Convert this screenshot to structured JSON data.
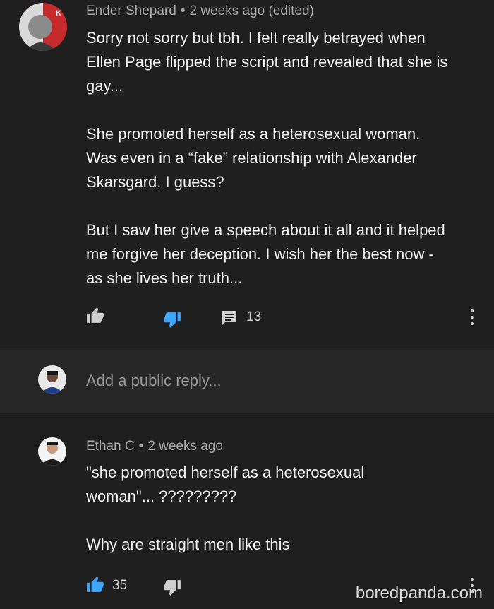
{
  "comment1": {
    "author": "Ender Shepard",
    "time": "2 weeks ago (edited)",
    "paragraphs": [
      [
        "Sorry not sorry but tbh. I felt really betrayed when",
        "Ellen Page flipped the script and revealed that she is",
        "gay..."
      ],
      [
        "She promoted herself as a heterosexual woman.",
        "Was even in a “fake” relationship with Alexander",
        "Skarsgard. I guess?"
      ],
      [
        "But I saw her give a speech about it all and it helped",
        "me forgive her deception. I wish her the best now -",
        "as she lives her truth..."
      ]
    ],
    "reply_count": "13"
  },
  "reply_box": {
    "placeholder": "Add a public reply..."
  },
  "comment2": {
    "author": "Ethan C",
    "time": "2 weeks ago",
    "paragraphs": [
      [
        "\"she promoted herself as a heterosexual",
        "woman\"... ?????????"
      ],
      [
        "Why are straight men like this"
      ]
    ],
    "like_count": "35"
  },
  "watermark": "boredpanda.com",
  "colors": {
    "accent": "#3ea6ff",
    "background": "#1f1f1f",
    "reply_bar": "#262626"
  },
  "icons": [
    "thumbs-up-icon",
    "thumbs-down-icon",
    "reply-icon",
    "more-vert-icon"
  ]
}
